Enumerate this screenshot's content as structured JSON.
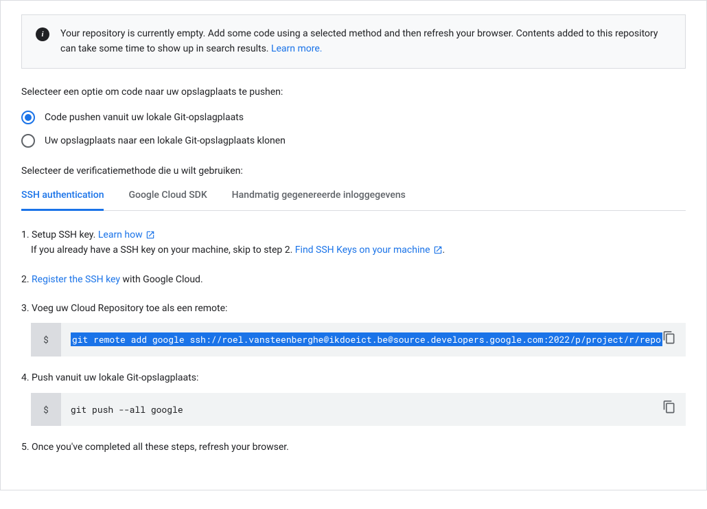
{
  "info": {
    "text": "Your repository is currently empty. Add some code using a selected method and then refresh your browser. Contents added to this repository can take some time to show up in search results. ",
    "learn_more": "Learn more."
  },
  "push_section": {
    "title": "Selecteer een optie om code naar uw opslagplaats te pushen:",
    "option_push": "Code pushen vanuit uw lokale Git-opslagplaats",
    "option_clone": "Uw opslagplaats naar een lokale Git-opslagplaats klonen"
  },
  "auth_section": {
    "title": "Selecteer de verificatiemethode die u wilt gebruiken:",
    "tabs": {
      "ssh": "SSH authentication",
      "sdk": "Google Cloud SDK",
      "manual": "Handmatig gegenereerde inloggegevens"
    }
  },
  "steps": {
    "s1_num": "1. ",
    "s1_a": "Setup SSH key. ",
    "s1_link": "Learn how",
    "s1_b": "If you already have a SSH key on your machine, skip to step 2. ",
    "s1_link2": "Find SSH Keys on your machine",
    "s1_c": ".",
    "s2_num": "2. ",
    "s2_link": "Register the SSH key",
    "s2_b": " with Google Cloud.",
    "s3_num": "3. ",
    "s3_text": "Voeg uw Cloud Repository toe als een remote:",
    "s3_cmd": "git remote add google ssh://roel.vansteenberghe@ikdoeict.be@source.developers.google.com:2022/p/project/r/repo",
    "s4_num": "4. ",
    "s4_text": "Push vanuit uw lokale Git-opslagplaats:",
    "s4_cmd": "git push --all google",
    "s5_num": "5. ",
    "s5_text": "Once you've completed all these steps, refresh your browser."
  }
}
